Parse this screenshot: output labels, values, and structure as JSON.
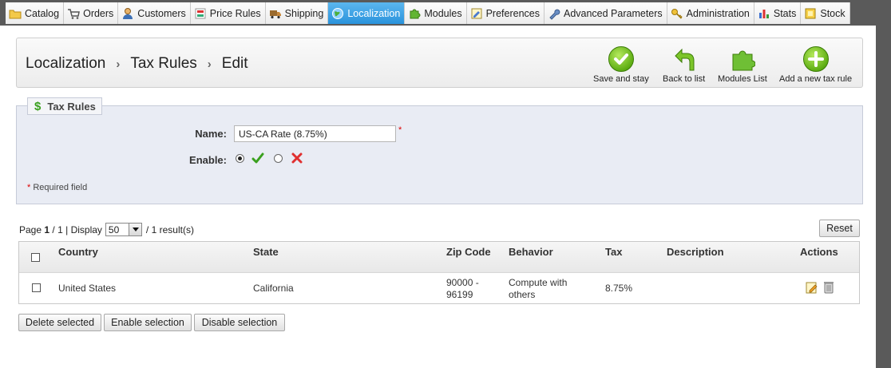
{
  "nav": {
    "tabs": [
      {
        "label": "Catalog",
        "icon": "folder-icon"
      },
      {
        "label": "Orders",
        "icon": "cart-icon"
      },
      {
        "label": "Customers",
        "icon": "user-icon"
      },
      {
        "label": "Price Rules",
        "icon": "price-tag-icon"
      },
      {
        "label": "Shipping",
        "icon": "truck-icon"
      },
      {
        "label": "Localization",
        "icon": "globe-icon",
        "active": true
      },
      {
        "label": "Modules",
        "icon": "puzzle-icon"
      },
      {
        "label": "Preferences",
        "icon": "preferences-icon"
      },
      {
        "label": "Advanced Parameters",
        "icon": "wrench-icon"
      },
      {
        "label": "Administration",
        "icon": "key-icon"
      },
      {
        "label": "Stats",
        "icon": "bar-chart-icon"
      },
      {
        "label": "Stock",
        "icon": "stock-box-icon"
      }
    ]
  },
  "breadcrumb": {
    "item1": "Localization",
    "item2": "Tax Rules",
    "item3": "Edit",
    "separator": "›"
  },
  "toolbar": {
    "save_stay": "Save and stay",
    "back": "Back to list",
    "modules": "Modules List",
    "add_new": "Add a new tax rule"
  },
  "form": {
    "legend": "Tax Rules",
    "legend_icon": "$",
    "name_label": "Name:",
    "name_value": "US-CA Rate (8.75%)",
    "enable_label": "Enable:",
    "enable_value": "yes",
    "required_star": "*",
    "required_note": "Required field"
  },
  "paging": {
    "page_prefix": "Page",
    "current_page": "1",
    "page_sep": "/",
    "total_pages": "1",
    "display_label": "| Display",
    "per_page": "50",
    "results": "/ 1 result(s)",
    "reset": "Reset"
  },
  "table": {
    "headers": [
      "Country",
      "State",
      "Zip Code",
      "Behavior",
      "Tax",
      "Description",
      "Actions"
    ],
    "rows": [
      {
        "country": "United States",
        "state": "California",
        "zip_line1": "90000 -",
        "zip_line2": "96199",
        "behavior_line1": "Compute with",
        "behavior_line2": "others",
        "tax": "8.75%",
        "description": ""
      }
    ]
  },
  "bulk": {
    "delete": "Delete selected",
    "enable": "Enable selection",
    "disable": "Disable selection"
  },
  "colors": {
    "nav_bg": "#5a5a5a",
    "active_tab": "#2a93dc",
    "panel_bg": "#e9ecf4",
    "accent_green": "#5fae14",
    "required_red": "#dd0000"
  }
}
